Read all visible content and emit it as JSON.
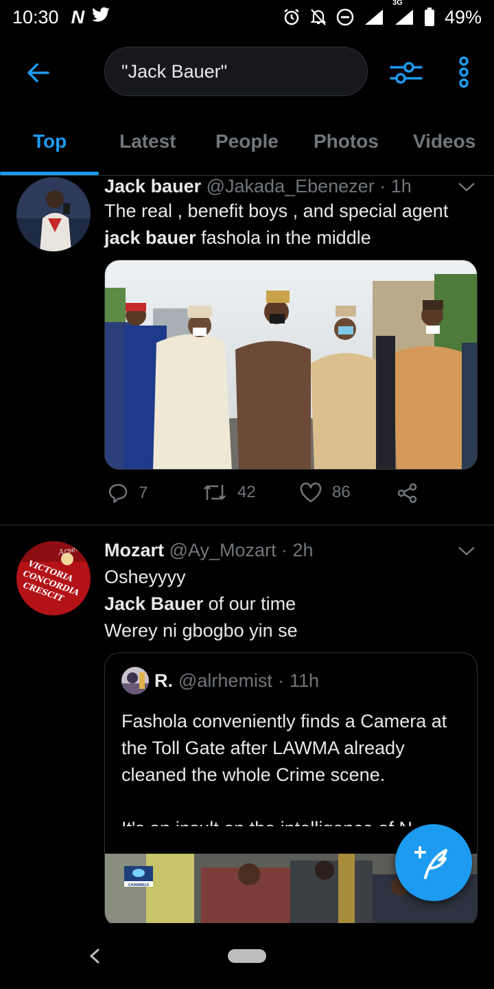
{
  "status_bar": {
    "time": "10:30",
    "left_icons": [
      "netflix-n-icon",
      "twitter-bird-icon"
    ],
    "network": "3G",
    "battery": "49%"
  },
  "header": {
    "search_value": "\"Jack Bauer\""
  },
  "tabs": [
    {
      "label": "Top",
      "active": true
    },
    {
      "label": "Latest",
      "active": false
    },
    {
      "label": "People",
      "active": false
    },
    {
      "label": "Photos",
      "active": false
    },
    {
      "label": "Videos",
      "active": false
    }
  ],
  "tweets": [
    {
      "name": "Jack bauer",
      "handle": "@Jakada_Ebenezer",
      "time": "1h",
      "text_before": "The real , benefit boys , and special agent ",
      "text_bold": "jack bauer",
      "text_after": " fashola in the middle",
      "replies": "7",
      "retweets": "42",
      "likes": "86"
    },
    {
      "name": "Mozart",
      "handle": "@Ay_Mozart",
      "time": "2h",
      "line1": "Osheyyyy",
      "line2_bold": "Jack Bauer",
      "line2_rest": " of our time",
      "line3": "Werey ni gbogbo yin se",
      "avatar_text": [
        "Arsenal",
        "VICTORIA",
        "CONCORDIA",
        "CRESCIT"
      ],
      "quote": {
        "name": "R.",
        "handle": "@alrhemist",
        "time": "11h",
        "text": "Fashola conveniently finds a Camera at the Toll Gate after LAWMA already cleaned the whole Crime scene.\n\nIt's an insult on the intelligence of N",
        "media_badge": "CHANNELS"
      }
    }
  ],
  "colors": {
    "accent": "#1d9bf0",
    "background": "#000000",
    "secondary_text": "#71767b"
  }
}
